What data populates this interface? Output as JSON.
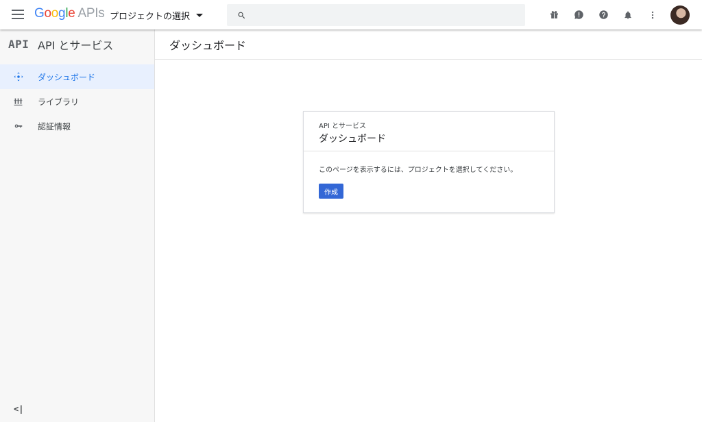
{
  "topbar": {
    "logo": {
      "google": "Google",
      "apis": "APIs"
    },
    "project_select": "プロジェクトの選択",
    "search_placeholder": "",
    "icons": [
      "gift-icon",
      "feedback-icon",
      "help-icon",
      "notifications-icon",
      "more-vert-icon"
    ]
  },
  "sidebar": {
    "header_mark": "API",
    "title": "API とサービス",
    "items": [
      {
        "label": "ダッシュボード",
        "icon": "dashboard-icon",
        "active": true
      },
      {
        "label": "ライブラリ",
        "icon": "library-icon",
        "active": false
      },
      {
        "label": "認証情報",
        "icon": "key-icon",
        "active": false
      }
    ],
    "collapse_label": "<|"
  },
  "main": {
    "title": "ダッシュボード",
    "card": {
      "subtitle": "API とサービス",
      "title": "ダッシュボード",
      "message": "このページを表示するには、プロジェクトを選択してください。",
      "button": "作成"
    }
  },
  "colors": {
    "accent": "#1a73e8",
    "button": "#3367d6",
    "active_bg": "#e8f0fe",
    "sidebar_bg": "#f7f7f7"
  }
}
